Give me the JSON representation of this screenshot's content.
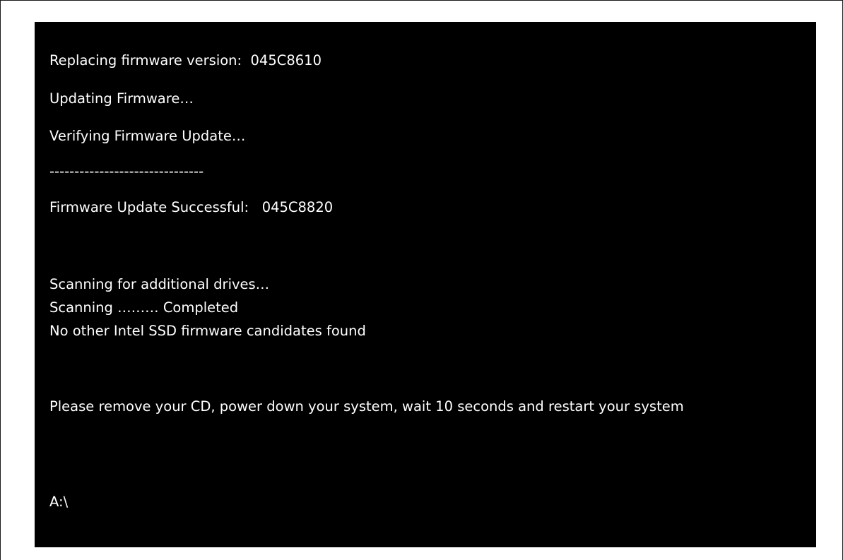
{
  "console": {
    "lines": {
      "replacing": "Replacing firmware version:  045C8610",
      "updating": "Updating Firmware…",
      "verifying": "Verifying Firmware Update…",
      "separator": "-------------------------------",
      "success": "Firmware Update Successful:   045C8820",
      "scanning_additional": "Scanning for additional drives…",
      "scanning_completed": "Scanning ……… Completed",
      "no_candidates": "No other Intel SSD firmware candidates found",
      "instruction": "Please remove your CD, power down your system, wait 10 seconds and restart your system",
      "prompt": "A:\\"
    }
  },
  "colors": {
    "console_background": "#000000",
    "console_text": "#ffffff",
    "page_background": "#ffffff",
    "frame_border": "#1a1a1a"
  }
}
